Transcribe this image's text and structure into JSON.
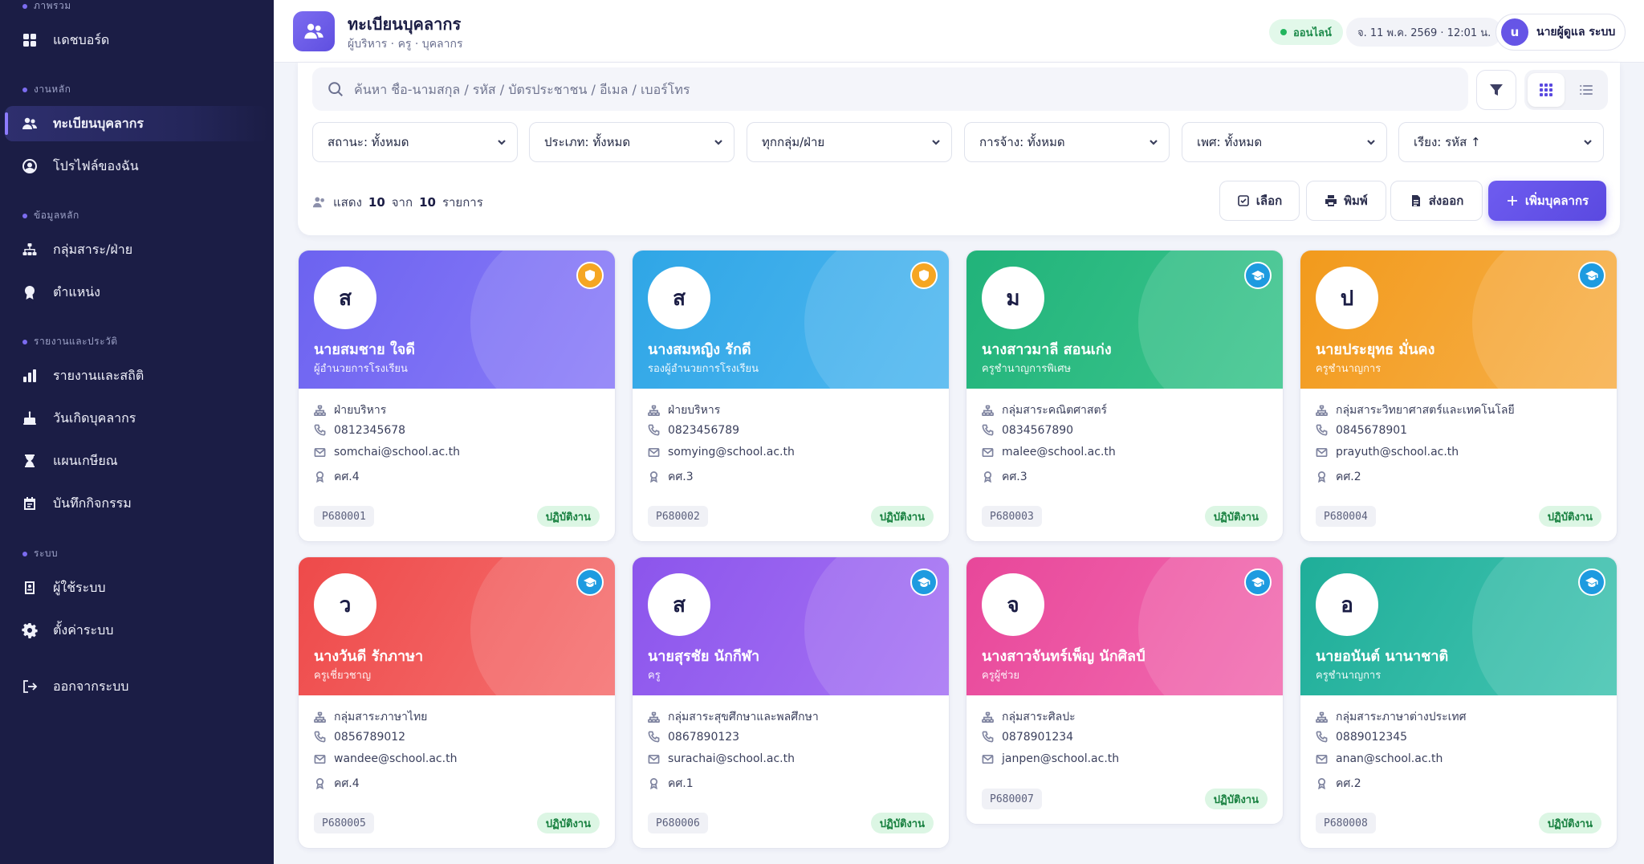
{
  "sidebar": {
    "sections": [
      {
        "label": "ภาพรวม"
      },
      {
        "label": "งานหลัก"
      },
      {
        "label": "ข้อมูลหลัก"
      },
      {
        "label": "รายงานและประวัติ"
      },
      {
        "label": "ระบบ"
      }
    ],
    "items": [
      {
        "label": "แดชบอร์ด",
        "icon": "grid-icon"
      },
      {
        "label": "ทะเบียนบุคลากร",
        "icon": "users-icon"
      },
      {
        "label": "โปรไฟล์ของฉัน",
        "icon": "user-circle-icon"
      },
      {
        "label": "กลุ่มสาระ/ฝ่าย",
        "icon": "sitemap-icon"
      },
      {
        "label": "ตำแหน่ง",
        "icon": "award-icon"
      },
      {
        "label": "รายงานและสถิติ",
        "icon": "bar-chart-icon"
      },
      {
        "label": "วันเกิดบุคลากร",
        "icon": "cake-icon"
      },
      {
        "label": "แผนเกษียณ",
        "icon": "hourglass-icon"
      },
      {
        "label": "บันทึกกิจกรรม",
        "icon": "calendar-log-icon"
      },
      {
        "label": "ผู้ใช้ระบบ",
        "icon": "id-badge-icon"
      },
      {
        "label": "ตั้งค่าระบบ",
        "icon": "gear-icon"
      },
      {
        "label": "ออกจากระบบ",
        "icon": "logout-icon"
      }
    ]
  },
  "header": {
    "title": "ทะเบียนบุคลากร",
    "subtitle": "ผู้บริหาร · ครู · บุคลากร",
    "status": "ออนไลน์",
    "datetime": "จ. 11 พ.ค. 2569 · 12:01 น.",
    "user_initial": "u",
    "user_name": "นายผู้ดูแล ระบบ"
  },
  "filters": {
    "search_placeholder": "ค้นหา ชื่อ-นามสกุล / รหัส / บัตรประชาชน / อีเมล / เบอร์โทร",
    "selects": [
      "สถานะ: ทั้งหมด",
      "ประเภท: ทั้งหมด",
      "ทุกกลุ่ม/ฝ่าย",
      "การจ้าง: ทั้งหมด",
      "เพศ: ทั้งหมด",
      "เรียง: รหัส ↑"
    ],
    "count_prefix": "แสดง",
    "count_shown": "10",
    "count_mid": "จาก",
    "count_total": "10",
    "count_suffix": "รายการ",
    "buttons": {
      "select": "เลือก",
      "print": "พิมพ์",
      "export": "ส่งออก",
      "add": "เพิ่มบุคลากร"
    }
  },
  "colors": {
    "accent": "#6655e6",
    "sidebar_bg": "#1b1d45",
    "status_green": "#1c8a4a"
  },
  "cards": [
    {
      "initial": "ส",
      "name": "นายสมชาย ใจดี",
      "position": "ผู้อำนวยการโรงเรียน",
      "dept": "ฝ่ายบริหาร",
      "phone": "0812345678",
      "email": "somchai@school.ac.th",
      "rank": "คศ.4",
      "code": "P680001",
      "status": "ปฏิบัติงาน",
      "badge": "shield-icon",
      "gradient": [
        "#6c63f0",
        "#8b7cf8"
      ],
      "badge_color": "#f5a623"
    },
    {
      "initial": "ส",
      "name": "นางสมหญิง รักดี",
      "position": "รองผู้อำนวยการโรงเรียน",
      "dept": "ฝ่ายบริหาร",
      "phone": "0823456789",
      "email": "somying@school.ac.th",
      "rank": "คศ.3",
      "code": "P680002",
      "status": "ปฏิบัติงาน",
      "badge": "shield-icon",
      "gradient": [
        "#2fa6e6",
        "#4fb7f0"
      ],
      "badge_color": "#f5a623"
    },
    {
      "initial": "ม",
      "name": "นางสาวมาลี สอนเก่ง",
      "position": "ครูชำนาญการพิเศษ",
      "dept": "กลุ่มสาระคณิตศาสตร์",
      "phone": "0834567890",
      "email": "malee@school.ac.th",
      "rank": "คศ.3",
      "code": "P680003",
      "status": "ปฏิบัติงาน",
      "badge": "graduation-cap-icon",
      "gradient": [
        "#21b37a",
        "#3cc58d"
      ],
      "badge_color": "#1e9be0"
    },
    {
      "initial": "ป",
      "name": "นายประยุทธ มั่นคง",
      "position": "ครูชำนาญการ",
      "dept": "กลุ่มสาระวิทยาศาสตร์และเทคโนโลยี",
      "phone": "0845678901",
      "email": "prayuth@school.ac.th",
      "rank": "คศ.2",
      "code": "P680004",
      "status": "ปฏิบัติงาน",
      "badge": "graduation-cap-icon",
      "gradient": [
        "#f29a1c",
        "#f7b04a"
      ],
      "badge_color": "#1e9be0"
    },
    {
      "initial": "ว",
      "name": "นางวันดี รักภาษา",
      "position": "ครูเชี่ยวชาญ",
      "dept": "กลุ่มสาระภาษาไทย",
      "phone": "0856789012",
      "email": "wandee@school.ac.th",
      "rank": "คศ.4",
      "code": "P680005",
      "status": "ปฏิบัติงาน",
      "badge": "graduation-cap-icon",
      "gradient": [
        "#ee4a4a",
        "#f57070"
      ],
      "badge_color": "#1e9be0"
    },
    {
      "initial": "ส",
      "name": "นายสุรชัย นักกีฬา",
      "position": "ครู",
      "dept": "กลุ่มสาระสุขศึกษาและพลศึกษา",
      "phone": "0867890123",
      "email": "surachai@school.ac.th",
      "rank": "คศ.1",
      "code": "P680006",
      "status": "ปฏิบัติงาน",
      "badge": "graduation-cap-icon",
      "gradient": [
        "#8c55ec",
        "#a673f4"
      ],
      "badge_color": "#1e9be0"
    },
    {
      "initial": "จ",
      "name": "นางสาวจันทร์เพ็ญ นักศิลป์",
      "position": "ครูผู้ช่วย",
      "dept": "กลุ่มสาระศิลปะ",
      "phone": "0878901234",
      "email": "janpen@school.ac.th",
      "rank": "",
      "code": "P680007",
      "status": "ปฏิบัติงาน",
      "badge": "graduation-cap-icon",
      "gradient": [
        "#e8479a",
        "#f26cb0"
      ],
      "badge_color": "#1e9be0"
    },
    {
      "initial": "อ",
      "name": "นายอนันต์ นานาชาติ",
      "position": "ครูชำนาญการ",
      "dept": "กลุ่มสาระภาษาต่างประเทศ",
      "phone": "0889012345",
      "email": "anan@school.ac.th",
      "rank": "คศ.2",
      "code": "P680008",
      "status": "ปฏิบัติงาน",
      "badge": "graduation-cap-icon",
      "gradient": [
        "#1fae99",
        "#43c4b1"
      ],
      "badge_color": "#1e9be0"
    }
  ]
}
